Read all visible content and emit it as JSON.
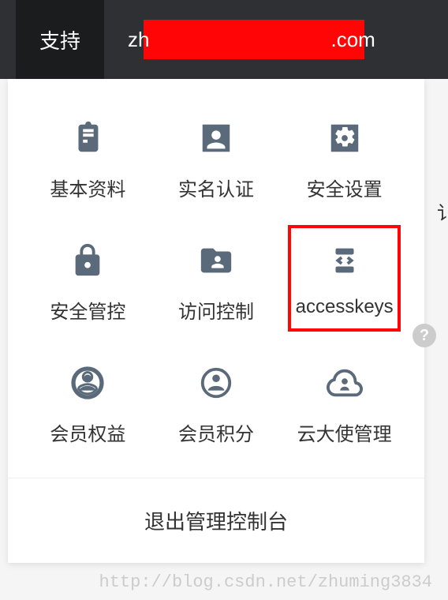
{
  "header": {
    "support_label": "支持",
    "user_prefix": "zh",
    "user_suffix": ".com"
  },
  "menu": {
    "items": [
      {
        "label": "基本资料",
        "icon": "clipboard-icon"
      },
      {
        "label": "实名认证",
        "icon": "person-icon"
      },
      {
        "label": "安全设置",
        "icon": "gear-icon"
      },
      {
        "label": "安全管控",
        "icon": "lock-icon"
      },
      {
        "label": "访问控制",
        "icon": "folder-person-icon"
      },
      {
        "label": "accesskeys",
        "icon": "code-bracket-icon",
        "highlighted": true
      },
      {
        "label": "会员权益",
        "icon": "user-circle-icon"
      },
      {
        "label": "会员积分",
        "icon": "user-circle-icon"
      },
      {
        "label": "云大使管理",
        "icon": "cloud-person-icon"
      }
    ]
  },
  "logout": {
    "label": "退出管理控制台"
  },
  "side": {
    "partial_text": "讠",
    "help_label": "?"
  },
  "watermark": "http://blog.csdn.net/zhuming3834"
}
